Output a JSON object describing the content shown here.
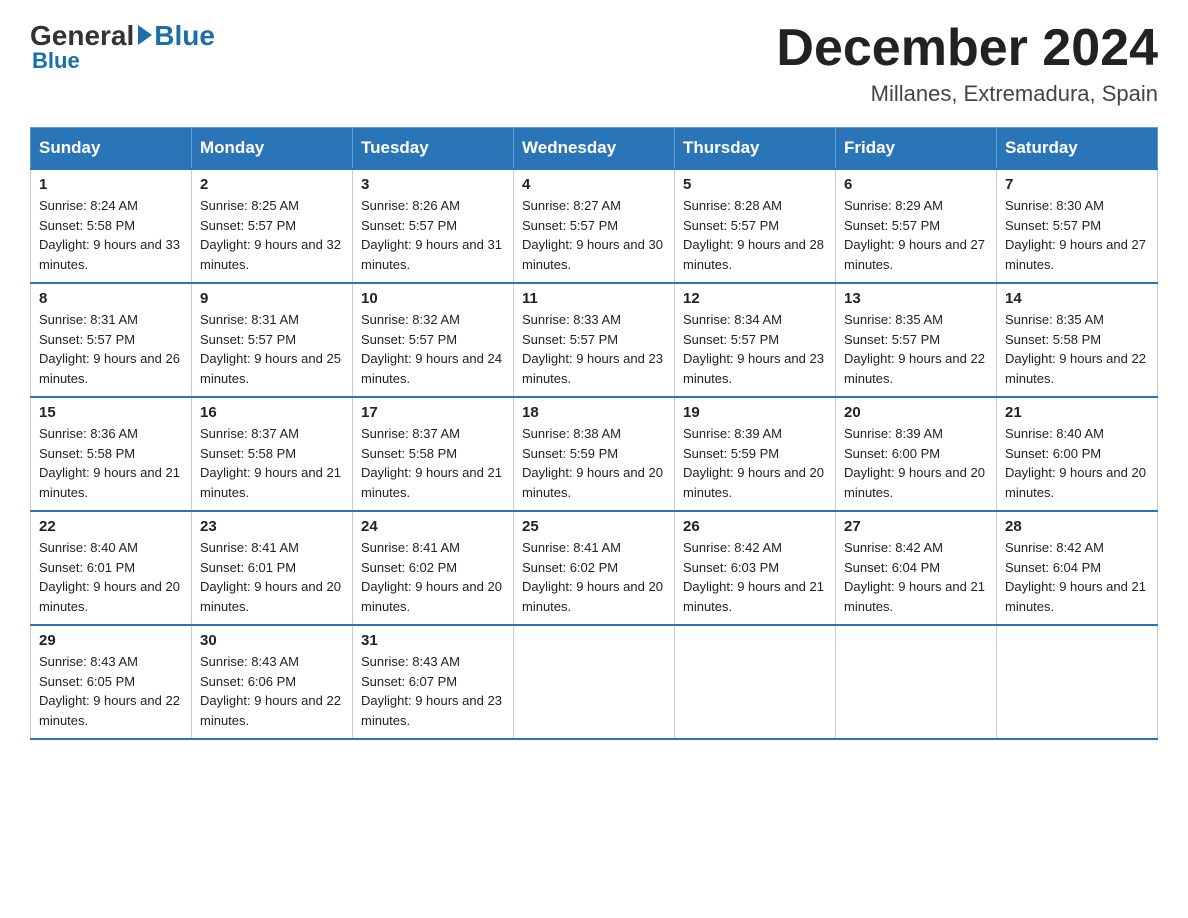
{
  "logo": {
    "general": "General",
    "blue": "Blue"
  },
  "title": {
    "month": "December 2024",
    "location": "Millanes, Extremadura, Spain"
  },
  "days_of_week": [
    "Sunday",
    "Monday",
    "Tuesday",
    "Wednesday",
    "Thursday",
    "Friday",
    "Saturday"
  ],
  "weeks": [
    [
      {
        "day": "1",
        "sunrise": "8:24 AM",
        "sunset": "5:58 PM",
        "daylight": "9 hours and 33 minutes."
      },
      {
        "day": "2",
        "sunrise": "8:25 AM",
        "sunset": "5:57 PM",
        "daylight": "9 hours and 32 minutes."
      },
      {
        "day": "3",
        "sunrise": "8:26 AM",
        "sunset": "5:57 PM",
        "daylight": "9 hours and 31 minutes."
      },
      {
        "day": "4",
        "sunrise": "8:27 AM",
        "sunset": "5:57 PM",
        "daylight": "9 hours and 30 minutes."
      },
      {
        "day": "5",
        "sunrise": "8:28 AM",
        "sunset": "5:57 PM",
        "daylight": "9 hours and 28 minutes."
      },
      {
        "day": "6",
        "sunrise": "8:29 AM",
        "sunset": "5:57 PM",
        "daylight": "9 hours and 27 minutes."
      },
      {
        "day": "7",
        "sunrise": "8:30 AM",
        "sunset": "5:57 PM",
        "daylight": "9 hours and 27 minutes."
      }
    ],
    [
      {
        "day": "8",
        "sunrise": "8:31 AM",
        "sunset": "5:57 PM",
        "daylight": "9 hours and 26 minutes."
      },
      {
        "day": "9",
        "sunrise": "8:31 AM",
        "sunset": "5:57 PM",
        "daylight": "9 hours and 25 minutes."
      },
      {
        "day": "10",
        "sunrise": "8:32 AM",
        "sunset": "5:57 PM",
        "daylight": "9 hours and 24 minutes."
      },
      {
        "day": "11",
        "sunrise": "8:33 AM",
        "sunset": "5:57 PM",
        "daylight": "9 hours and 23 minutes."
      },
      {
        "day": "12",
        "sunrise": "8:34 AM",
        "sunset": "5:57 PM",
        "daylight": "9 hours and 23 minutes."
      },
      {
        "day": "13",
        "sunrise": "8:35 AM",
        "sunset": "5:57 PM",
        "daylight": "9 hours and 22 minutes."
      },
      {
        "day": "14",
        "sunrise": "8:35 AM",
        "sunset": "5:58 PM",
        "daylight": "9 hours and 22 minutes."
      }
    ],
    [
      {
        "day": "15",
        "sunrise": "8:36 AM",
        "sunset": "5:58 PM",
        "daylight": "9 hours and 21 minutes."
      },
      {
        "day": "16",
        "sunrise": "8:37 AM",
        "sunset": "5:58 PM",
        "daylight": "9 hours and 21 minutes."
      },
      {
        "day": "17",
        "sunrise": "8:37 AM",
        "sunset": "5:58 PM",
        "daylight": "9 hours and 21 minutes."
      },
      {
        "day": "18",
        "sunrise": "8:38 AM",
        "sunset": "5:59 PM",
        "daylight": "9 hours and 20 minutes."
      },
      {
        "day": "19",
        "sunrise": "8:39 AM",
        "sunset": "5:59 PM",
        "daylight": "9 hours and 20 minutes."
      },
      {
        "day": "20",
        "sunrise": "8:39 AM",
        "sunset": "6:00 PM",
        "daylight": "9 hours and 20 minutes."
      },
      {
        "day": "21",
        "sunrise": "8:40 AM",
        "sunset": "6:00 PM",
        "daylight": "9 hours and 20 minutes."
      }
    ],
    [
      {
        "day": "22",
        "sunrise": "8:40 AM",
        "sunset": "6:01 PM",
        "daylight": "9 hours and 20 minutes."
      },
      {
        "day": "23",
        "sunrise": "8:41 AM",
        "sunset": "6:01 PM",
        "daylight": "9 hours and 20 minutes."
      },
      {
        "day": "24",
        "sunrise": "8:41 AM",
        "sunset": "6:02 PM",
        "daylight": "9 hours and 20 minutes."
      },
      {
        "day": "25",
        "sunrise": "8:41 AM",
        "sunset": "6:02 PM",
        "daylight": "9 hours and 20 minutes."
      },
      {
        "day": "26",
        "sunrise": "8:42 AM",
        "sunset": "6:03 PM",
        "daylight": "9 hours and 21 minutes."
      },
      {
        "day": "27",
        "sunrise": "8:42 AM",
        "sunset": "6:04 PM",
        "daylight": "9 hours and 21 minutes."
      },
      {
        "day": "28",
        "sunrise": "8:42 AM",
        "sunset": "6:04 PM",
        "daylight": "9 hours and 21 minutes."
      }
    ],
    [
      {
        "day": "29",
        "sunrise": "8:43 AM",
        "sunset": "6:05 PM",
        "daylight": "9 hours and 22 minutes."
      },
      {
        "day": "30",
        "sunrise": "8:43 AM",
        "sunset": "6:06 PM",
        "daylight": "9 hours and 22 minutes."
      },
      {
        "day": "31",
        "sunrise": "8:43 AM",
        "sunset": "6:07 PM",
        "daylight": "9 hours and 23 minutes."
      },
      null,
      null,
      null,
      null
    ]
  ]
}
